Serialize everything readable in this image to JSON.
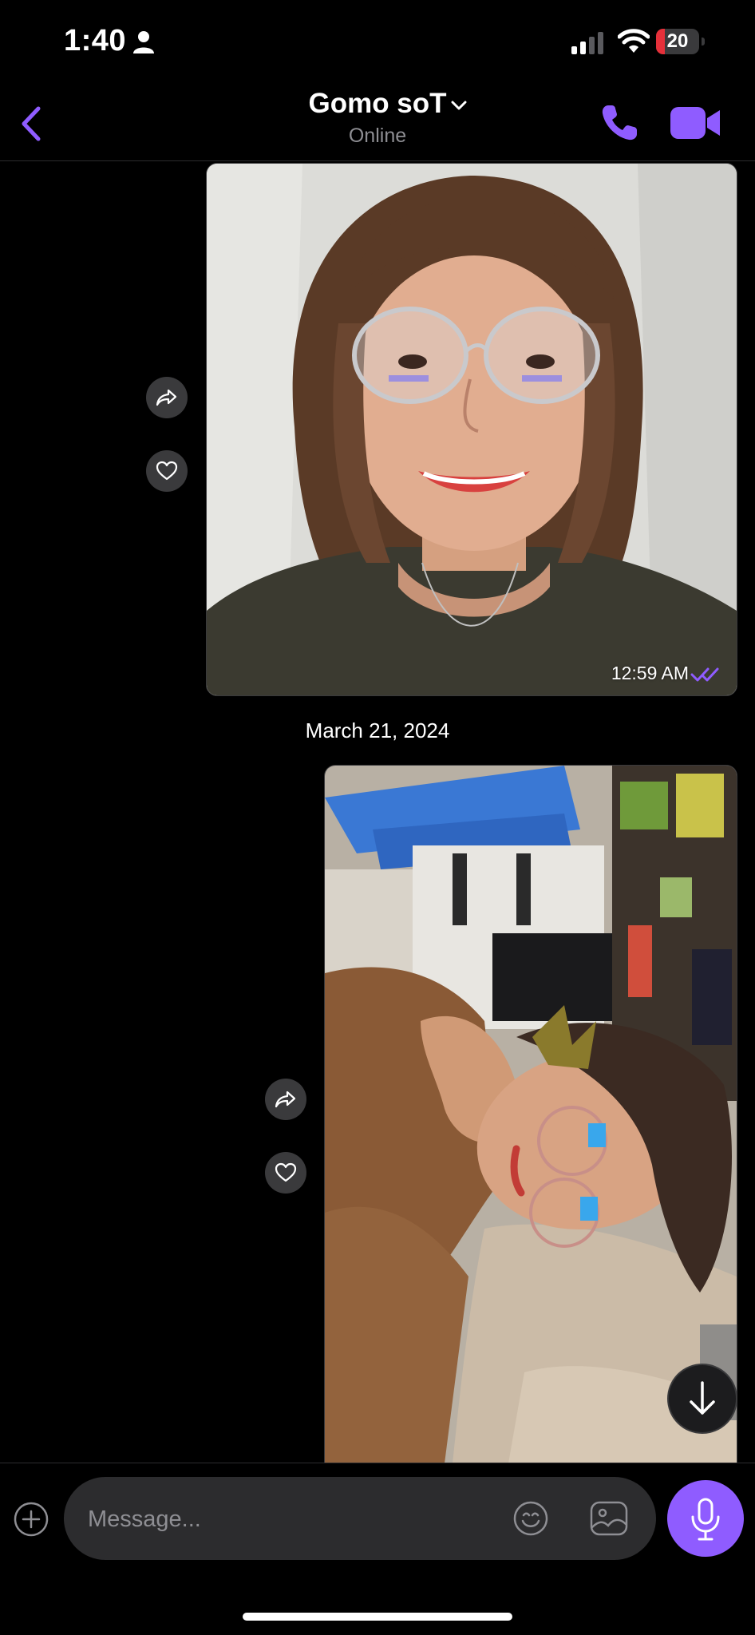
{
  "status_bar": {
    "time": "1:40",
    "battery": "20",
    "battery_level": 0.2
  },
  "header": {
    "contact_name": "Gomo soT",
    "contact_status": "Online"
  },
  "messages": [
    {
      "type": "photo",
      "time": "12:59 AM",
      "status": "read",
      "photo_description_icon": "photo-woman-glasses-icon"
    },
    {
      "type": "date",
      "label": "March 21, 2024"
    },
    {
      "type": "photo",
      "photo_description_icon": "photo-selfie-rotated-icon"
    }
  ],
  "composer": {
    "placeholder": "Message..."
  },
  "colors": {
    "accent": "#8f5cff",
    "background": "#000000",
    "input_background": "#2c2c2e",
    "battery_low": "#e5303a"
  }
}
